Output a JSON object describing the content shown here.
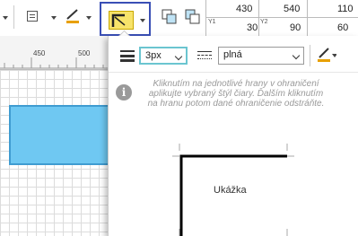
{
  "coords": {
    "top_row": [
      "430",
      "540",
      "110"
    ],
    "bottom_row": [
      "30",
      "90",
      "60"
    ],
    "labels": [
      "Y1",
      "Y2"
    ]
  },
  "ruler": {
    "marks": [
      "450",
      "500"
    ]
  },
  "popup": {
    "thickness": {
      "value": "3px"
    },
    "style": {
      "value": "plná"
    },
    "info_text": "Kliknutím na jednotlivé hrany v ohraničení aplikujte vybraný štýl čiary. Ďalším kliknutím na hranu potom dané ohraničenie odstráňte.",
    "preview_label": "Ukážka"
  },
  "colors": {
    "accent_border": "#3a4fb5",
    "shape_fill": "#6fc8f2",
    "highlight": "#f7e36a"
  }
}
